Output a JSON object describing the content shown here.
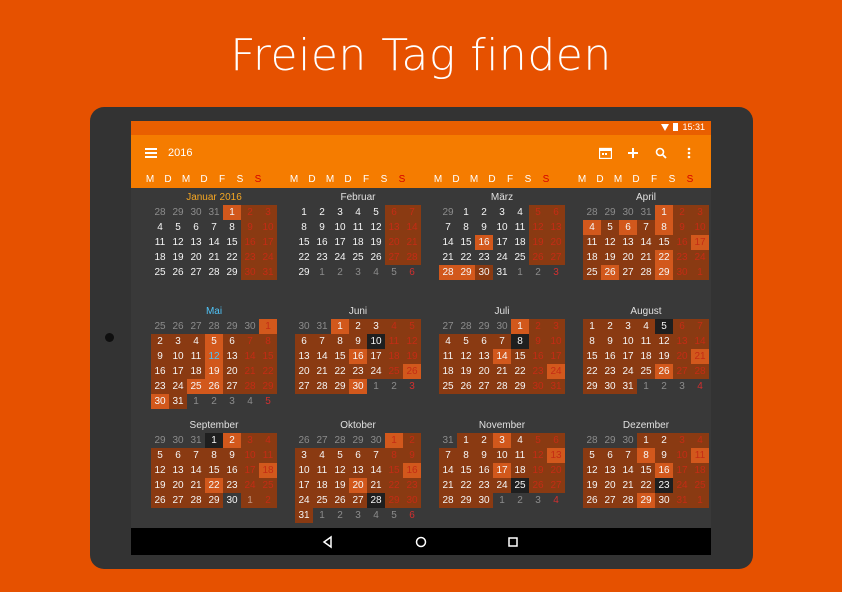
{
  "headline": "Freien Tag finden",
  "status": {
    "time": "15:31"
  },
  "toolbar": {
    "title": "2016"
  },
  "weekdays": [
    "M",
    "D",
    "M",
    "D",
    "F",
    "S",
    "S"
  ],
  "months": [
    {
      "name": "Januar 2016",
      "style": "accent",
      "weeks": [
        [
          "28",
          "29",
          "30",
          "31",
          "1",
          "2",
          "3"
        ],
        [
          "4",
          "5",
          "6",
          "7",
          "8",
          "9",
          "10"
        ],
        [
          "11",
          "12",
          "13",
          "14",
          "15",
          "16",
          "17"
        ],
        [
          "18",
          "19",
          "20",
          "21",
          "22",
          "23",
          "24"
        ],
        [
          "25",
          "26",
          "27",
          "28",
          "29",
          "30",
          "31"
        ]
      ]
    },
    {
      "name": "Februar",
      "style": "",
      "weeks": [
        [
          "1",
          "2",
          "3",
          "4",
          "5",
          "6",
          "7"
        ],
        [
          "8",
          "9",
          "10",
          "11",
          "12",
          "13",
          "14"
        ],
        [
          "15",
          "16",
          "17",
          "18",
          "19",
          "20",
          "21"
        ],
        [
          "22",
          "23",
          "24",
          "25",
          "26",
          "27",
          "28"
        ],
        [
          "29",
          "1",
          "2",
          "3",
          "4",
          "5",
          "6"
        ]
      ]
    },
    {
      "name": "März",
      "style": "",
      "weeks": [
        [
          "29",
          "1",
          "2",
          "3",
          "4",
          "5",
          "6"
        ],
        [
          "7",
          "8",
          "9",
          "10",
          "11",
          "12",
          "13"
        ],
        [
          "14",
          "15",
          "16",
          "17",
          "18",
          "19",
          "20"
        ],
        [
          "21",
          "22",
          "23",
          "24",
          "25",
          "26",
          "27"
        ],
        [
          "28",
          "29",
          "30",
          "31",
          "1",
          "2",
          "3"
        ]
      ]
    },
    {
      "name": "April",
      "style": "",
      "weeks": [
        [
          "28",
          "29",
          "30",
          "31",
          "1",
          "2",
          "3"
        ],
        [
          "4",
          "5",
          "6",
          "7",
          "8",
          "9",
          "10"
        ],
        [
          "11",
          "12",
          "13",
          "14",
          "15",
          "16",
          "17"
        ],
        [
          "18",
          "19",
          "20",
          "21",
          "22",
          "23",
          "24"
        ],
        [
          "25",
          "26",
          "27",
          "28",
          "29",
          "30",
          "1"
        ]
      ]
    },
    {
      "name": "Mai",
      "style": "blue",
      "weeks": [
        [
          "25",
          "26",
          "27",
          "28",
          "29",
          "30",
          "1"
        ],
        [
          "2",
          "3",
          "4",
          "5",
          "6",
          "7",
          "8"
        ],
        [
          "9",
          "10",
          "11",
          "12",
          "13",
          "14",
          "15"
        ],
        [
          "16",
          "17",
          "18",
          "19",
          "20",
          "21",
          "22"
        ],
        [
          "23",
          "24",
          "25",
          "26",
          "27",
          "28",
          "29"
        ],
        [
          "30",
          "31",
          "1",
          "2",
          "3",
          "4",
          "5"
        ]
      ]
    },
    {
      "name": "Juni",
      "style": "",
      "weeks": [
        [
          "30",
          "31",
          "1",
          "2",
          "3",
          "4",
          "5"
        ],
        [
          "6",
          "7",
          "8",
          "9",
          "10",
          "11",
          "12"
        ],
        [
          "13",
          "14",
          "15",
          "16",
          "17",
          "18",
          "19"
        ],
        [
          "20",
          "21",
          "22",
          "23",
          "24",
          "25",
          "26"
        ],
        [
          "27",
          "28",
          "29",
          "30",
          "1",
          "2",
          "3"
        ]
      ]
    },
    {
      "name": "Juli",
      "style": "",
      "weeks": [
        [
          "27",
          "28",
          "29",
          "30",
          "1",
          "2",
          "3"
        ],
        [
          "4",
          "5",
          "6",
          "7",
          "8",
          "9",
          "10"
        ],
        [
          "11",
          "12",
          "13",
          "14",
          "15",
          "16",
          "17"
        ],
        [
          "18",
          "19",
          "20",
          "21",
          "22",
          "23",
          "24"
        ],
        [
          "25",
          "26",
          "27",
          "28",
          "29",
          "30",
          "31"
        ]
      ]
    },
    {
      "name": "August",
      "style": "",
      "weeks": [
        [
          "1",
          "2",
          "3",
          "4",
          "5",
          "6",
          "7"
        ],
        [
          "8",
          "9",
          "10",
          "11",
          "12",
          "13",
          "14"
        ],
        [
          "15",
          "16",
          "17",
          "18",
          "19",
          "20",
          "21"
        ],
        [
          "22",
          "23",
          "24",
          "25",
          "26",
          "27",
          "28"
        ],
        [
          "29",
          "30",
          "31",
          "1",
          "2",
          "3",
          "4"
        ]
      ]
    },
    {
      "name": "September",
      "style": "",
      "weeks": [
        [
          "29",
          "30",
          "31",
          "1",
          "2",
          "3",
          "4"
        ],
        [
          "5",
          "6",
          "7",
          "8",
          "9",
          "10",
          "11"
        ],
        [
          "12",
          "13",
          "14",
          "15",
          "16",
          "17",
          "18"
        ],
        [
          "19",
          "20",
          "21",
          "22",
          "23",
          "24",
          "25"
        ],
        [
          "26",
          "27",
          "28",
          "29",
          "30",
          "1",
          "2"
        ]
      ]
    },
    {
      "name": "Oktober",
      "style": "",
      "weeks": [
        [
          "26",
          "27",
          "28",
          "29",
          "30",
          "1",
          "2"
        ],
        [
          "3",
          "4",
          "5",
          "6",
          "7",
          "8",
          "9"
        ],
        [
          "10",
          "11",
          "12",
          "13",
          "14",
          "15",
          "16"
        ],
        [
          "17",
          "18",
          "19",
          "20",
          "21",
          "22",
          "23"
        ],
        [
          "24",
          "25",
          "26",
          "27",
          "28",
          "29",
          "30"
        ],
        [
          "31",
          "1",
          "2",
          "3",
          "4",
          "5",
          "6"
        ]
      ]
    },
    {
      "name": "November",
      "style": "",
      "weeks": [
        [
          "31",
          "1",
          "2",
          "3",
          "4",
          "5",
          "6"
        ],
        [
          "7",
          "8",
          "9",
          "10",
          "11",
          "12",
          "13"
        ],
        [
          "14",
          "15",
          "16",
          "17",
          "18",
          "19",
          "20"
        ],
        [
          "21",
          "22",
          "23",
          "24",
          "25",
          "26",
          "27"
        ],
        [
          "28",
          "29",
          "30",
          "1",
          "2",
          "3",
          "4"
        ]
      ]
    },
    {
      "name": "Dezember",
      "style": "",
      "weeks": [
        [
          "28",
          "29",
          "30",
          "1",
          "2",
          "3",
          "4"
        ],
        [
          "5",
          "6",
          "7",
          "8",
          "9",
          "10",
          "11"
        ],
        [
          "12",
          "13",
          "14",
          "15",
          "16",
          "17",
          "18"
        ],
        [
          "19",
          "20",
          "21",
          "22",
          "23",
          "24",
          "25"
        ],
        [
          "26",
          "27",
          "28",
          "29",
          "30",
          "31",
          "1"
        ]
      ]
    }
  ],
  "colors": {
    "background": "#e65100",
    "toolbar": "#f57c00",
    "selected": "#8a3a12",
    "highlight": "#d2581c",
    "sunday": "#d32f2f"
  },
  "icons": {
    "menu": "hamburger-icon",
    "today": "calendar-today-icon",
    "add": "plus-icon",
    "search": "search-icon",
    "more": "more-vert-icon",
    "back": "nav-back-icon",
    "home": "nav-home-icon",
    "recents": "nav-recents-icon"
  }
}
